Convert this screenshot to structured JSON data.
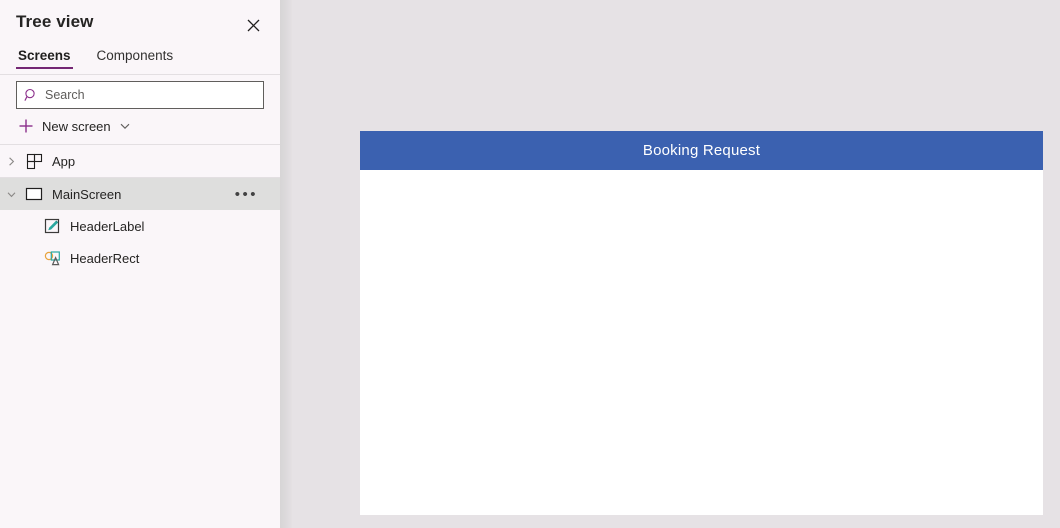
{
  "panel": {
    "title": "Tree view",
    "close_icon": "close-icon",
    "tabs": [
      {
        "label": "Screens",
        "active": true
      },
      {
        "label": "Components",
        "active": false
      }
    ],
    "search": {
      "placeholder": "Search",
      "value": "",
      "icon": "search-icon"
    },
    "new_screen": {
      "label": "New screen",
      "plus_icon": "plus-icon",
      "chevron_icon": "chevron-down-icon"
    },
    "tree": [
      {
        "label": "App",
        "icon": "app-grid-icon",
        "chevron": "chevron-right-icon",
        "level": 0,
        "selected": false,
        "has_overflow": false
      },
      {
        "label": "MainScreen",
        "icon": "screen-rectangle-icon",
        "chevron": "chevron-down-icon",
        "level": 0,
        "selected": true,
        "has_overflow": true,
        "overflow_label": "•••"
      },
      {
        "label": "HeaderLabel",
        "icon": "label-pencil-icon",
        "chevron": "",
        "level": 1,
        "selected": false,
        "has_overflow": false
      },
      {
        "label": "HeaderRect",
        "icon": "shapes-icon",
        "chevron": "",
        "level": 1,
        "selected": false,
        "has_overflow": false
      }
    ]
  },
  "canvas": {
    "screen": {
      "name": "MainScreen",
      "header_text": "Booking Request",
      "header_color": "#3b61b0",
      "body_color": "#ffffff"
    },
    "background_color": "#e6e2e5"
  },
  "theme": {
    "panel_background": "#faf6f9",
    "accent": "#742774",
    "selected_row": "#dededd",
    "text": "#252423"
  }
}
